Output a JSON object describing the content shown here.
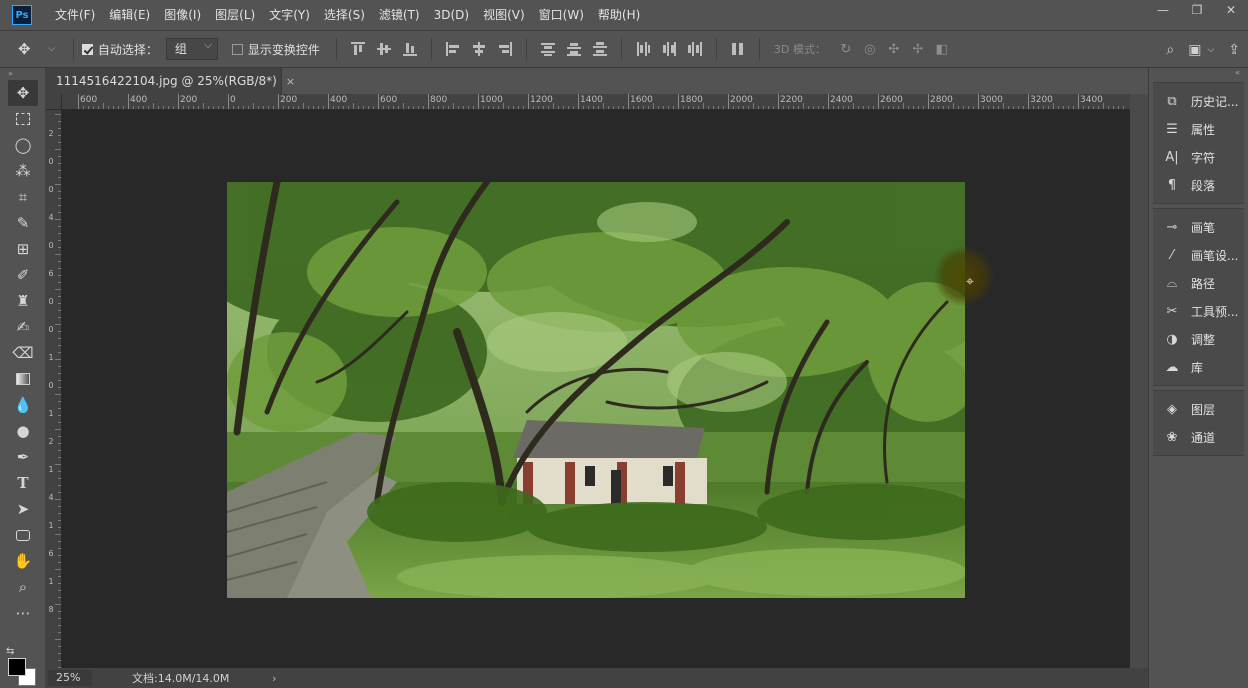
{
  "app": {
    "logo": "Ps"
  },
  "menu": [
    "文件(F)",
    "编辑(E)",
    "图像(I)",
    "图层(L)",
    "文字(Y)",
    "选择(S)",
    "滤镜(T)",
    "3D(D)",
    "视图(V)",
    "窗口(W)",
    "帮助(H)"
  ],
  "window_controls": {
    "minimize": "—",
    "restore": "❐",
    "close": "✕"
  },
  "options": {
    "auto_select_label": "自动选择：",
    "auto_select_checked": true,
    "auto_select_value": "组",
    "show_transform_label": "显示变换控件",
    "show_transform_checked": false,
    "mode_3d_label": "3D 模式："
  },
  "document": {
    "tab_title": "1114516422104.jpg @ 25%(RGB/8*)",
    "close": "×"
  },
  "ruler_top": [
    "600",
    "400",
    "200",
    "0",
    "200",
    "400",
    "600",
    "800",
    "1000",
    "1200",
    "1400",
    "1600",
    "1800",
    "2000",
    "2200",
    "2400",
    "2600",
    "2800",
    "3000",
    "3200",
    "3400"
  ],
  "ruler_left": [
    "2",
    "0",
    "0",
    "4",
    "0",
    "6",
    "0",
    "0",
    "1",
    "0",
    "1",
    "2",
    "1",
    "4",
    "1",
    "6",
    "1",
    "8"
  ],
  "status": {
    "zoom": "25%",
    "doc_info": "文档:14.0M/14.0M",
    "arrow": "›"
  },
  "panels": [
    [
      {
        "icon": "history-icon",
        "label": "历史记..."
      },
      {
        "icon": "properties-icon",
        "label": "属性"
      },
      {
        "icon": "character-icon",
        "label": "字符"
      },
      {
        "icon": "paragraph-icon",
        "label": "段落"
      }
    ],
    [
      {
        "icon": "brush-icon",
        "label": "画笔"
      },
      {
        "icon": "brush-settings-icon",
        "label": "画笔设..."
      },
      {
        "icon": "paths-icon",
        "label": "路径"
      },
      {
        "icon": "tool-presets-icon",
        "label": "工具预..."
      },
      {
        "icon": "adjustments-icon",
        "label": "调整"
      },
      {
        "icon": "libraries-icon",
        "label": "库"
      }
    ],
    [
      {
        "icon": "layers-icon",
        "label": "图层"
      },
      {
        "icon": "channels-icon",
        "label": "通道"
      }
    ]
  ],
  "colors": {
    "foreground": "#000000",
    "background": "#ffffff",
    "accent": "#31a8ff"
  }
}
